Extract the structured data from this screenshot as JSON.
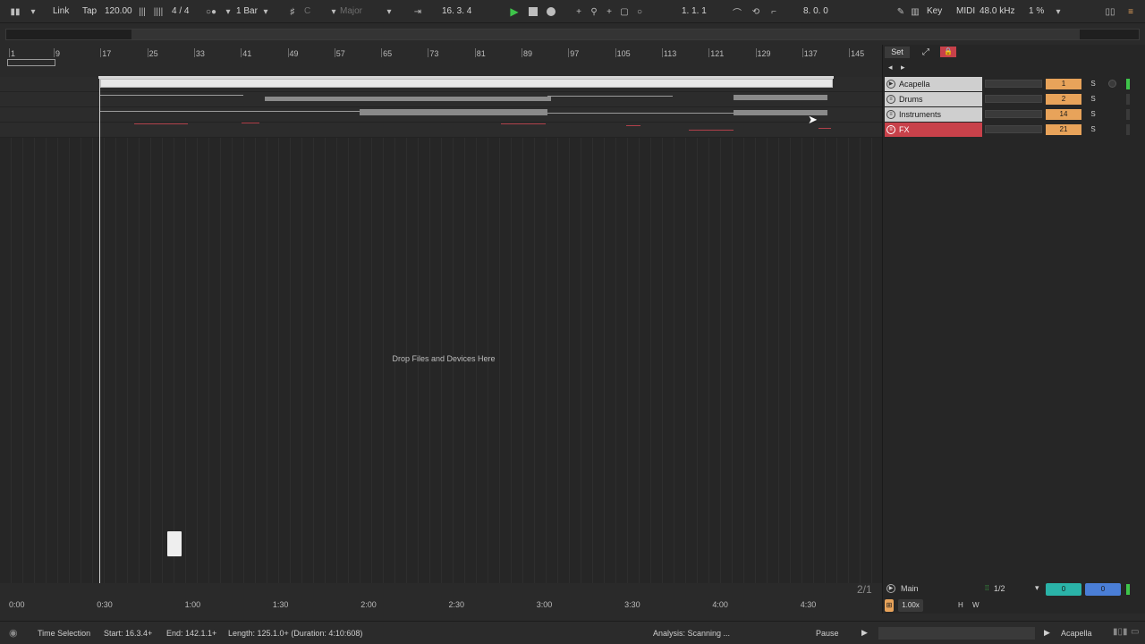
{
  "topbar": {
    "link": "Link",
    "tap": "Tap",
    "tempo": "120.00",
    "signature": "4 / 4",
    "quantize": "1 Bar",
    "key": "C",
    "scale": "Major",
    "position": "16.  3.  4",
    "loop_start": "1.   1.   1",
    "loop_length": "8.   0.   0",
    "key_button": "Key",
    "midi_button": "MIDI",
    "sample_rate": "48.0 kHz",
    "cpu": "1 %"
  },
  "ruler": {
    "bars": [
      "1",
      "9",
      "17",
      "25",
      "33",
      "41",
      "49",
      "57",
      "65",
      "73",
      "81",
      "89",
      "97",
      "105",
      "113",
      "121",
      "129",
      "137",
      "145"
    ]
  },
  "arrangement": {
    "drop_text": "Drop Files and Devices Here",
    "zoom_ratio": "2/1"
  },
  "time_ruler": {
    "labels": [
      "0:00",
      "0:30",
      "1:00",
      "1:30",
      "2:00",
      "2:30",
      "3:00",
      "3:30",
      "4:00",
      "4:30"
    ]
  },
  "right_panel": {
    "set_label": "Set",
    "tracks": [
      {
        "name": "Acapella",
        "number": "1",
        "solo": "S",
        "color": "#cfcfcf"
      },
      {
        "name": "Drums",
        "number": "2",
        "solo": "S",
        "color": "#cfcfcf"
      },
      {
        "name": "Instruments",
        "number": "14",
        "solo": "S",
        "color": "#cfcfcf"
      },
      {
        "name": "FX",
        "number": "21",
        "solo": "S",
        "color": "#c8414a"
      }
    ],
    "main": {
      "name": "Main",
      "routing": "1/2",
      "cue_left": "0",
      "cue_right": "0",
      "speed": "1.00x",
      "h": "H",
      "w": "W"
    }
  },
  "statusbar": {
    "time_selection": "Time Selection",
    "start": "Start: 16.3.4+",
    "end": "End: 142.1.1+",
    "length": "Length: 125.1.0+ (Duration: 4:10:608)",
    "analysis": "Analysis: Scanning ...",
    "pause": "Pause",
    "track": "Acapella"
  },
  "colors": {
    "accent_orange": "#e8a35a",
    "play_green": "#3ec44a",
    "fx_red": "#c8414a",
    "cue_teal": "#2ab3a8",
    "cue_blue": "#4a7ed6"
  }
}
